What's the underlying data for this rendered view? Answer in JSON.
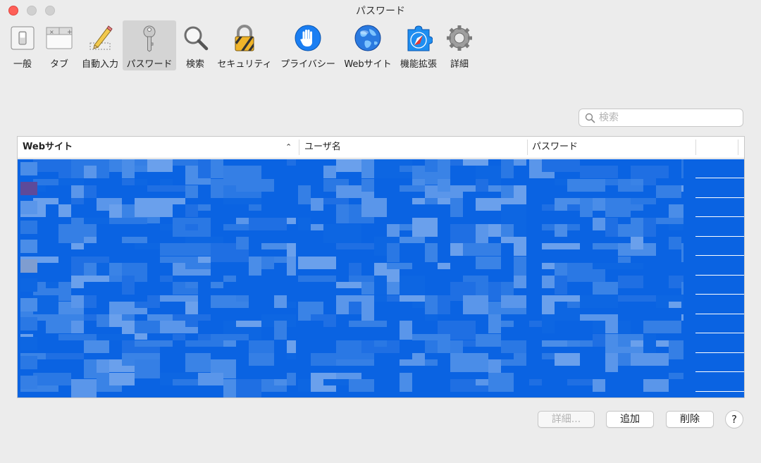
{
  "window": {
    "title": "パスワード"
  },
  "toolbar": {
    "items": [
      {
        "label": "一般",
        "icon": "general-switch-icon"
      },
      {
        "label": "タブ",
        "icon": "tabs-icon"
      },
      {
        "label": "自動入力",
        "icon": "autofill-pencil-icon"
      },
      {
        "label": "パスワード",
        "icon": "key-icon",
        "selected": true
      },
      {
        "label": "検索",
        "icon": "magnifier-icon"
      },
      {
        "label": "セキュリティ",
        "icon": "padlock-icon"
      },
      {
        "label": "プライバシー",
        "icon": "privacy-hand-icon"
      },
      {
        "label": "Webサイト",
        "icon": "globe-icon"
      },
      {
        "label": "機能拡張",
        "icon": "extensions-puzzle-icon"
      },
      {
        "label": "詳細",
        "icon": "advanced-gear-icon"
      }
    ]
  },
  "search": {
    "placeholder": "検索",
    "value": ""
  },
  "table": {
    "columns": [
      {
        "label": "Webサイト",
        "sort": "ascending"
      },
      {
        "label": "ユーザ名"
      },
      {
        "label": "パスワード"
      }
    ],
    "row_count": 12,
    "rows_state": "selected-all, contents pixelated"
  },
  "buttons": {
    "details": "詳細...",
    "add": "追加",
    "remove": "削除",
    "help": "?"
  },
  "colors": {
    "selection": "#0a63e2",
    "close": "#fe5f57",
    "window_bg": "#ececec"
  }
}
